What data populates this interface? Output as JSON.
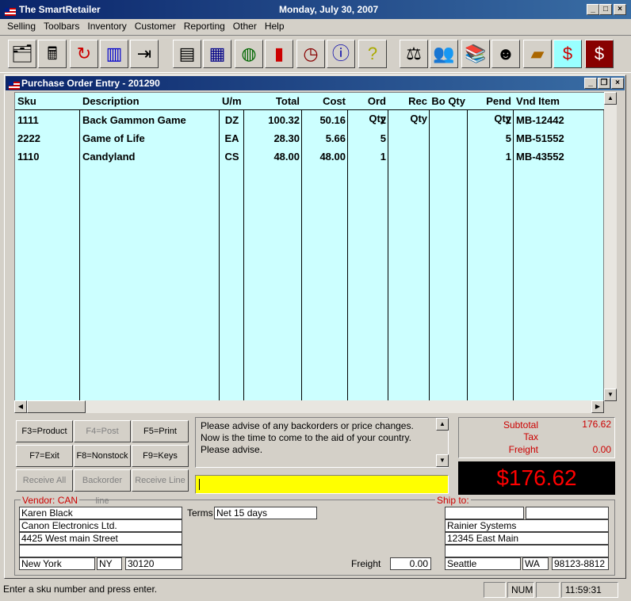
{
  "app": {
    "title": "The SmartRetailer",
    "date": "Monday, July 30, 2007"
  },
  "menu": [
    "Selling",
    "Toolbars",
    "Inventory",
    "Customer",
    "Reporting",
    "Other",
    "Help"
  ],
  "toolbar": {
    "icons": [
      "cash-register-icon",
      "cash-drawer-icon",
      "refresh-icon",
      "chart-icon",
      "exit-door-icon",
      "report-icon",
      "calculator-icon",
      "globe-icon",
      "book-icon",
      "clock-icon",
      "info-icon",
      "help-icon",
      "scale-icon",
      "people-icon",
      "books-icon",
      "person-icon",
      "folders-icon",
      "dollar-icon",
      "dollar-docs-icon"
    ]
  },
  "window": {
    "title": "Purchase Order Entry - 201290"
  },
  "grid": {
    "headers": [
      "Sku",
      "Description",
      "U/m",
      "Total",
      "Cost",
      "Ord Qty",
      "Rec Qty",
      "Bo Qty",
      "Pend Qty",
      "Vnd Item"
    ],
    "rows": [
      [
        "1111",
        "Back Gammon Game",
        "DZ",
        "100.32",
        "50.16",
        "2",
        "",
        "",
        "2",
        "MB-12442"
      ],
      [
        "2222",
        "Game of Life",
        "EA",
        "28.30",
        "5.66",
        "5",
        "",
        "",
        "5",
        "MB-51552"
      ],
      [
        "1110",
        "Candyland",
        "CS",
        "48.00",
        "48.00",
        "1",
        "",
        "",
        "1",
        "MB-43552"
      ]
    ]
  },
  "buttons": {
    "product": "F3=Product",
    "post": "F4=Post",
    "print": "F5=Print",
    "exit": "F7=Exit",
    "nonstock": "F8=Nonstock",
    "keys": "F9=Keys",
    "receive_all": "Receive All",
    "backorder": "Backorder line",
    "receive_line": "Receive Line"
  },
  "memo": {
    "line1": "Please advise of any backorders or price changes.",
    "line2": "Now is the time to come to the aid of your country.",
    "line3": "Please advise."
  },
  "totals": {
    "subtotal_label": "Subtotal",
    "subtotal": "176.62",
    "tax_label": "Tax",
    "tax": "",
    "freight_label": "Freight",
    "freight": "0.00",
    "grand": "$176.62"
  },
  "vendor": {
    "legend": "Vendor: CAN",
    "name": "Karen Black",
    "company": "Canon Electronics Ltd.",
    "street": "4425 West main Street",
    "line4": "",
    "city": "New York",
    "state": "NY",
    "zip": "30120"
  },
  "terms": {
    "label": "Terms",
    "value": "Net 15 days"
  },
  "freight": {
    "label": "Freight",
    "value": "0.00"
  },
  "shipto": {
    "legend": "Ship to:",
    "f1": "",
    "f2": "",
    "company": "Rainier Systems",
    "street": "12345 East Main",
    "line4": "",
    "city": "Seattle",
    "state": "WA",
    "zip": "98123-8812"
  },
  "status": {
    "message": "Enter a sku number and press enter.",
    "num": "NUM",
    "time": "11:59:31 am"
  }
}
